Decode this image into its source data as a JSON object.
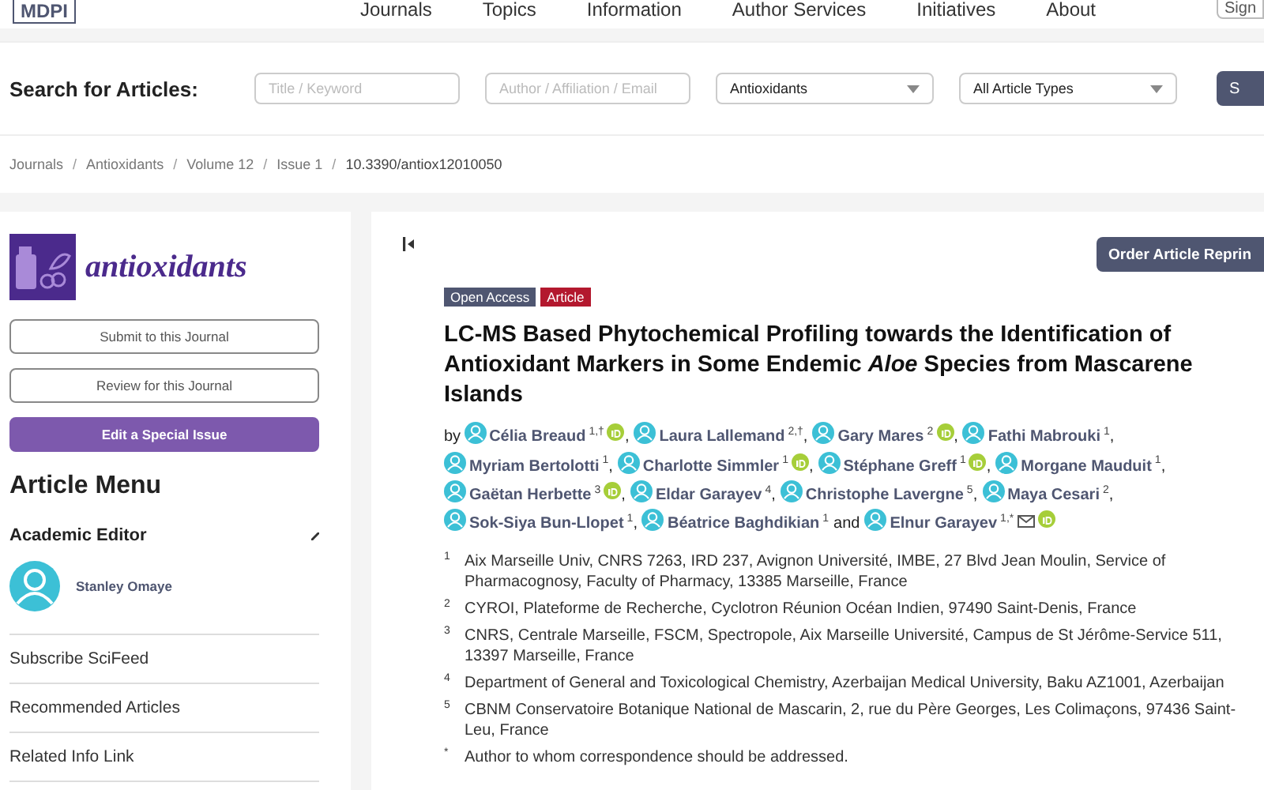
{
  "header": {
    "logo": "MDPI",
    "nav": [
      "Journals",
      "Topics",
      "Information",
      "Author Services",
      "Initiatives",
      "About"
    ],
    "sign_in": "Sign"
  },
  "search": {
    "label": "Search for Articles:",
    "fields": [
      {
        "placeholder": "Title / Keyword"
      },
      {
        "placeholder": "Author / Affiliation / Email"
      }
    ],
    "selects": [
      "Antioxidants",
      "All Article Types"
    ],
    "button": "S"
  },
  "breadcrumbs": {
    "separator": "/",
    "items": [
      "Journals",
      "Antioxidants",
      "Volume 12",
      "Issue 1",
      "10.3390/antiox12010050"
    ]
  },
  "sidebar": {
    "journal": "antioxidants",
    "buttons": [
      {
        "label": "Submit to this Journal",
        "kind": "outline"
      },
      {
        "label": "Review for this Journal",
        "kind": "outline"
      },
      {
        "label": "Edit a Special Issue",
        "kind": "filled"
      }
    ],
    "menu_title": "Article Menu",
    "editor_heading": "Academic Editor",
    "editor": "Stanley Omaye",
    "items": [
      "Subscribe SciFeed",
      "Recommended Articles",
      "Related Info Link"
    ]
  },
  "article": {
    "order_button": "Order Article Reprin",
    "tags": [
      {
        "label": "Open Access",
        "color": "#4f5671"
      },
      {
        "label": "Article",
        "color": "#b3182e"
      }
    ],
    "title": "LC-MS Based Phytochemical Profiling towards the Identification of Antioxidant Markers in Some Endemic *Aloe* Species from Mascarene Islands",
    "by": "by",
    "authors": [
      {
        "name": "Célia Breaud",
        "sup": "1,†",
        "orcid": true,
        "email": false,
        "after": ","
      },
      {
        "name": "Laura Lallemand",
        "sup": "2,†",
        "orcid": false,
        "email": false,
        "after": ","
      },
      {
        "name": "Gary Mares",
        "sup": "2",
        "orcid": true,
        "email": false,
        "after": ","
      },
      {
        "name": "Fathi Mabrouki",
        "sup": "1",
        "orcid": false,
        "email": false,
        "after": ","
      },
      {
        "name": "Myriam Bertolotti",
        "sup": "1",
        "orcid": false,
        "email": false,
        "after": ","
      },
      {
        "name": "Charlotte Simmler",
        "sup": "1",
        "orcid": true,
        "email": false,
        "after": ","
      },
      {
        "name": "Stéphane Greff",
        "sup": "1",
        "orcid": true,
        "email": false,
        "after": ","
      },
      {
        "name": "Morgane Mauduit",
        "sup": "1",
        "orcid": false,
        "email": false,
        "after": ","
      },
      {
        "name": "Gaëtan Herbette",
        "sup": "3",
        "orcid": true,
        "email": false,
        "after": ","
      },
      {
        "name": "Eldar Garayev",
        "sup": "4",
        "orcid": false,
        "email": false,
        "after": ","
      },
      {
        "name": "Christophe Lavergne",
        "sup": "5",
        "orcid": false,
        "email": false,
        "after": ","
      },
      {
        "name": "Maya Cesari",
        "sup": "2",
        "orcid": false,
        "email": false,
        "after": ","
      },
      {
        "name": "Sok-Siya Bun-Llopet",
        "sup": "1",
        "orcid": false,
        "email": false,
        "after": ","
      },
      {
        "name": "Béatrice Baghdikian",
        "sup": "1",
        "orcid": false,
        "email": false,
        "after": "and"
      },
      {
        "name": "Elnur Garayev",
        "sup": "1,*",
        "orcid": true,
        "email": true
      }
    ],
    "affiliations": [
      {
        "mark": "1",
        "text": "Aix Marseille Univ, CNRS 7263, IRD 237, Avignon Université, IMBE, 27 Blvd Jean Moulin, Service of Pharmacognosy, Faculty of Pharmacy, 13385 Marseille, France"
      },
      {
        "mark": "2",
        "text": "CYROI, Plateforme de Recherche, Cyclotron Réunion Océan Indien, 97490 Saint-Denis, France"
      },
      {
        "mark": "3",
        "text": "CNRS, Centrale Marseille, FSCM, Spectropole, Aix Marseille Université, Campus de St Jérôme-Service 511, 13397 Marseille, France"
      },
      {
        "mark": "4",
        "text": "Department of General and Toxicological Chemistry, Azerbaijan Medical University, Baku AZ1001, Azerbaijan"
      },
      {
        "mark": "5",
        "text": "CBNM Conservatoire Botanique National de Mascarin, 2, rue du Père Georges, Les Colimaçons, 97436 Saint-Leu, France"
      },
      {
        "mark": "*",
        "text": "Author to whom correspondence should be addressed."
      }
    ]
  }
}
